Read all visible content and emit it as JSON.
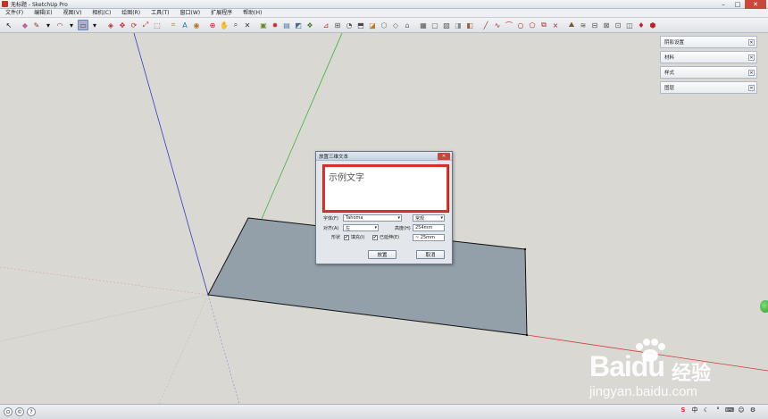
{
  "window": {
    "title": "无标题 - SketchUp Pro"
  },
  "menu": [
    "文件(F)",
    "编辑(E)",
    "视图(V)",
    "相机(C)",
    "绘图(R)",
    "工具(T)",
    "窗口(W)",
    "扩展程序",
    "帮助(H)"
  ],
  "trays": [
    {
      "label": "阴影设置"
    },
    {
      "label": "材料"
    },
    {
      "label": "样式"
    },
    {
      "label": "图层"
    }
  ],
  "dialog": {
    "title": "放置三维文本",
    "text_value": "示例文字",
    "font_label": "字体(F)",
    "font_value": "Tahoma",
    "style_value": "常规",
    "align_label": "对齐(A)",
    "align_value": "左",
    "height_label": "高度(H)",
    "height_value": "254mm",
    "form_label": "形状",
    "fill_label": "填充(I)",
    "fill_checked": true,
    "extrude_label": "已延伸(E)",
    "extrude_checked": true,
    "extrude_value": "~ 25mm",
    "place_button": "放置",
    "cancel_button": "取消"
  },
  "watermark": {
    "brand": "Baidu",
    "brand_cn": "经验",
    "url": "jingyan.baidu.com"
  },
  "colors": {
    "viewport_bg": "#d9d8d2",
    "face_fill": "#939fa9",
    "axis_red": "#d63a3a",
    "axis_green": "#3bb53b",
    "axis_blue": "#3a3ac8",
    "highlight_red": "#e0342c"
  }
}
